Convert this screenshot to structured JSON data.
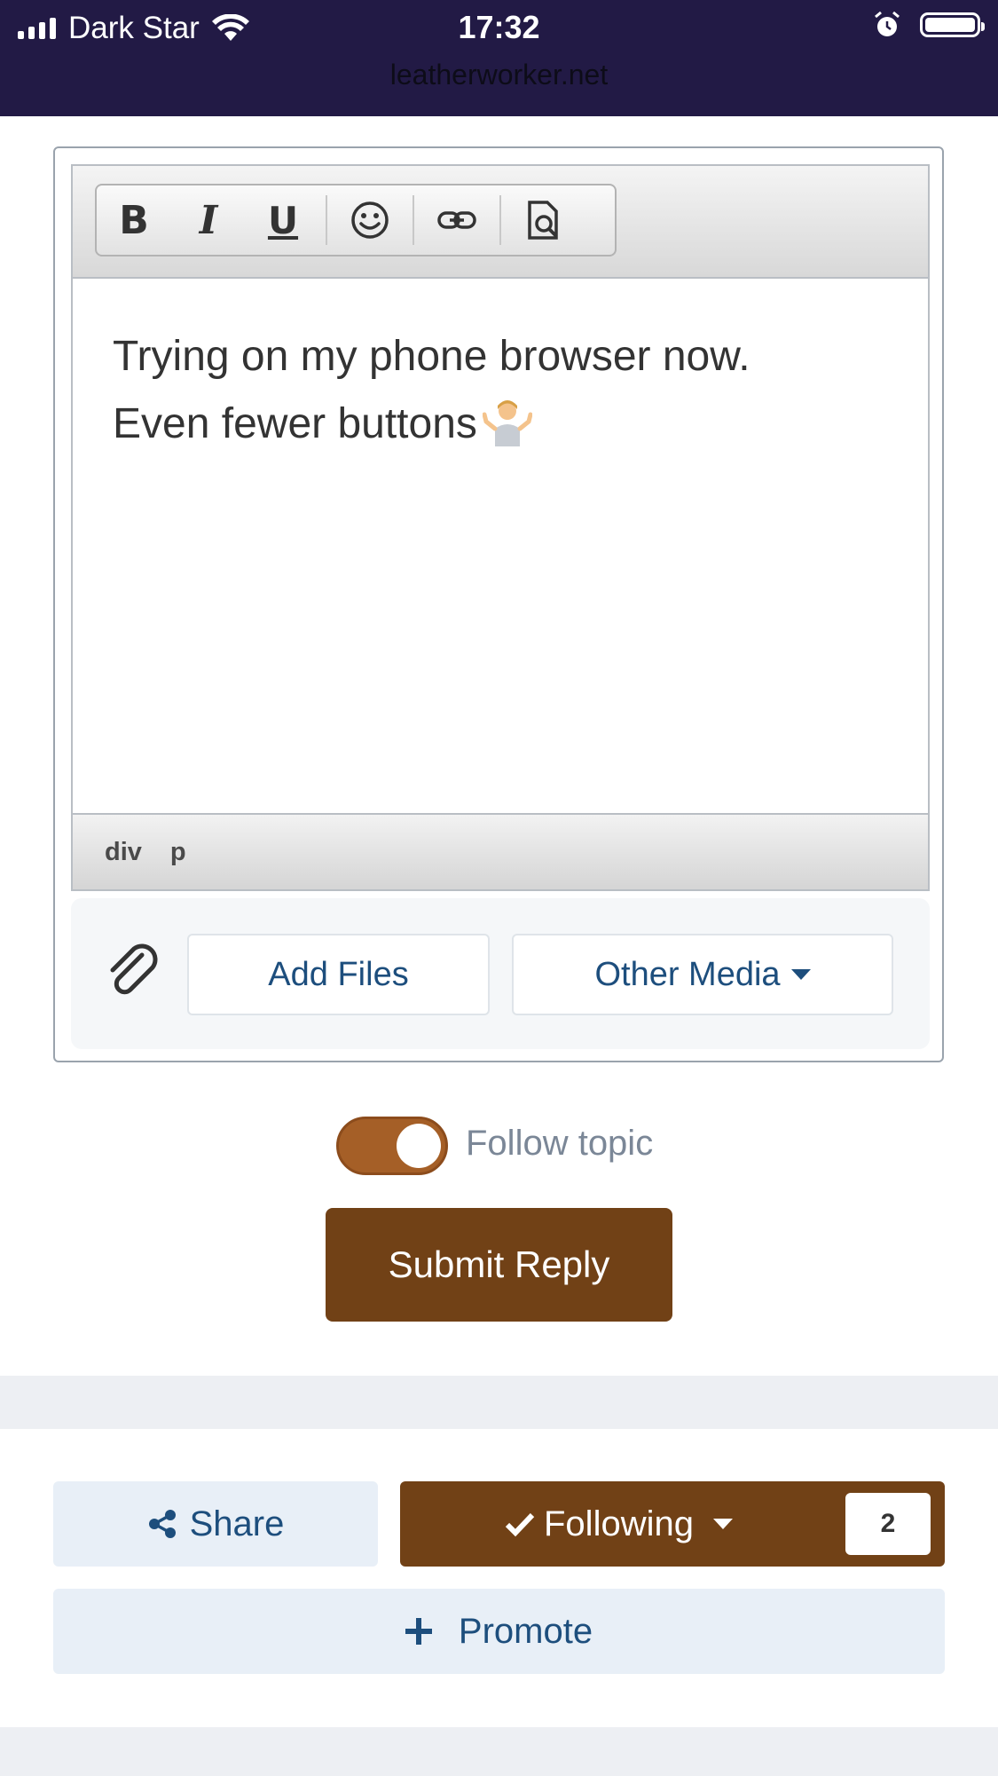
{
  "status_bar": {
    "carrier": "Dark Star",
    "time": "17:32",
    "url": "leatherworker.net",
    "icons": [
      "signal-icon",
      "wifi-icon",
      "alarm-icon",
      "battery-icon"
    ]
  },
  "editor": {
    "toolbar": {
      "bold_label": "B",
      "italic_label": "I",
      "underline_label": "U",
      "icons": [
        "emoji-icon",
        "link-icon",
        "preview-icon"
      ]
    },
    "content_line1": "Trying on my phone browser now.",
    "content_line2": "Even fewer buttons",
    "content_emoji": "person-shrugging-emoji",
    "path": [
      "div",
      "p"
    ]
  },
  "attachments": {
    "add_files_label": "Add Files",
    "other_media_label": "Other Media"
  },
  "follow": {
    "label": "Follow topic",
    "enabled": true
  },
  "submit_label": "Submit Reply",
  "actions": {
    "share_label": "Share",
    "following_label": "Following",
    "following_count": "2",
    "promote_label": "Promote"
  },
  "colors": {
    "status_bar_bg": "#221a45",
    "primary_brown": "#714116",
    "toggle_on": "#a55f27",
    "link_blue": "#1d4e7d",
    "light_button_bg": "#e8eff7"
  }
}
